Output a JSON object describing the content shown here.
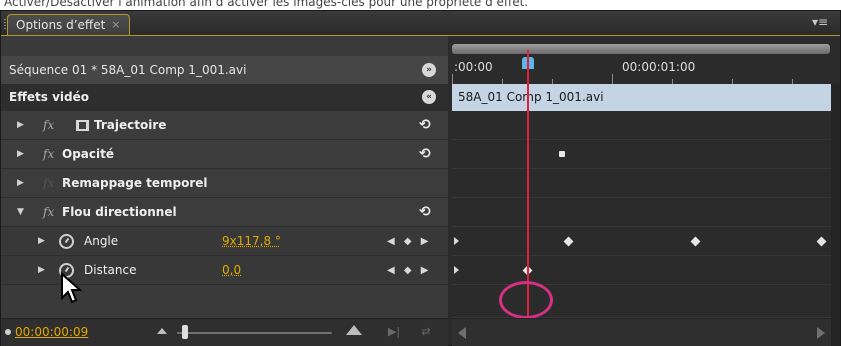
{
  "caption": "Activer/Désactiver l’animation  afin d’activer les images-clés pour une propriété d’effet.",
  "tab": {
    "label": "Options d’effet",
    "close": "×"
  },
  "panel_menu": "▾≡",
  "sequence": {
    "label": "Séquence 01 * 58A_01 Comp 1_001.avi",
    "toggle_icon": "»"
  },
  "section": {
    "label": "Effets vidéo",
    "toggle_icon": "«"
  },
  "effects": [
    {
      "label": "Trajectoire",
      "reset": "⟲"
    },
    {
      "label": "Opacité",
      "reset": "⟲"
    },
    {
      "label": "Remappage temporel"
    },
    {
      "label": "Flou directionnel",
      "reset": "⟲"
    }
  ],
  "properties": [
    {
      "label": "Angle",
      "value": "9x117,8 °"
    },
    {
      "label": "Distance",
      "value": "0,0"
    }
  ],
  "footer": {
    "timecode": "00:00:00:09"
  },
  "timeline": {
    "ruler_start": ":00:00",
    "ruler_mid": "00:00:01:00",
    "clip_label": "58A_01 Comp 1_001.avi"
  },
  "colors": {
    "accent_value": "#e0a800",
    "playhead": "#e0203a",
    "highlight": "#d63084",
    "clip": "#c4d4e4"
  }
}
